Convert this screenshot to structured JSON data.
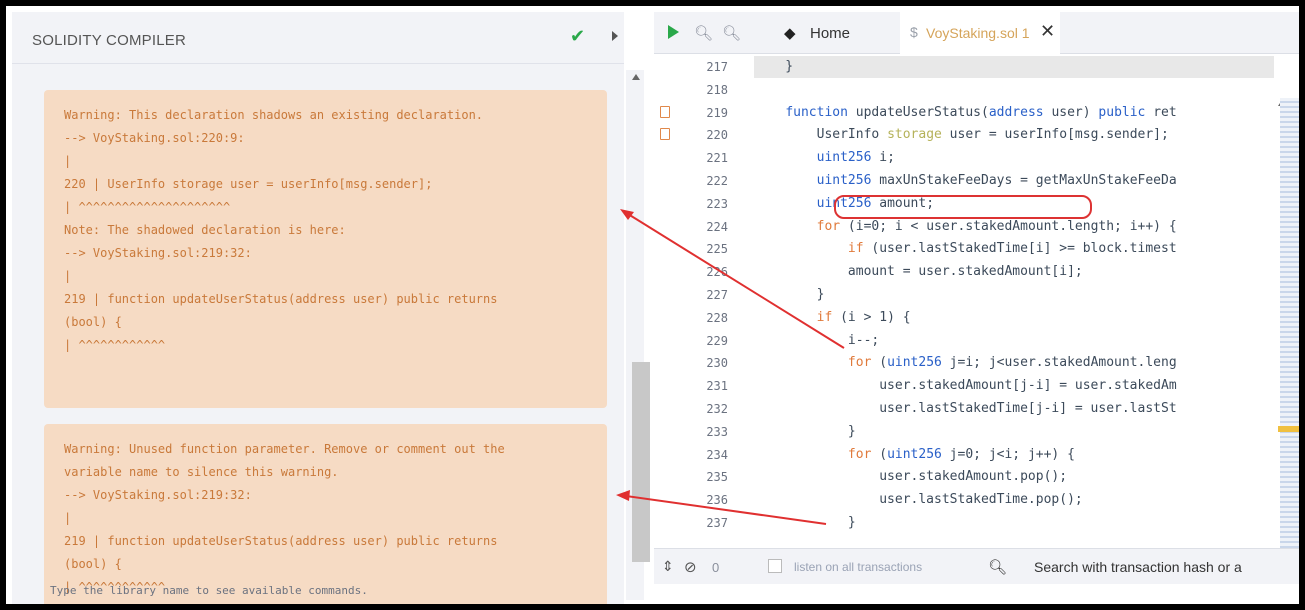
{
  "left_panel": {
    "title": "SOLIDITY COMPILER",
    "warnings": [
      "Warning: This declaration shadows an existing declaration.\n--> VoyStaking.sol:220:9:\n|\n220 | UserInfo storage user = userInfo[msg.sender];\n| ^^^^^^^^^^^^^^^^^^^^^\nNote: The shadowed declaration is here:\n--> VoyStaking.sol:219:32:\n|\n219 | function updateUserStatus(address user) public returns\n(bool) {\n| ^^^^^^^^^^^^",
      "Warning: Unused function parameter. Remove or comment out the\nvariable name to silence this warning.\n--> VoyStaking.sol:219:32:\n|\n219 | function updateUserStatus(address user) public returns\n(bool) {\n| ^^^^^^^^^^^^"
    ]
  },
  "editor": {
    "tabs": {
      "home": "Home",
      "file": "VoyStaking.sol",
      "file_suffix": "1"
    },
    "lines": [
      {
        "n": "217",
        "text": "    }"
      },
      {
        "n": "218",
        "text": ""
      },
      {
        "n": "219",
        "text": "    function updateUserStatus(address user) public ret"
      },
      {
        "n": "220",
        "text": "        UserInfo storage user = userInfo[msg.sender];"
      },
      {
        "n": "221",
        "text": "        uint256 i;"
      },
      {
        "n": "222",
        "text": "        uint256 maxUnStakeFeeDays = getMaxUnStakeFeeDa"
      },
      {
        "n": "223",
        "text": "        uint256 amount;"
      },
      {
        "n": "224",
        "text": "        for (i=0; i < user.stakedAmount.length; i++) {"
      },
      {
        "n": "225",
        "text": "            if (user.lastStakedTime[i] >= block.timest"
      },
      {
        "n": "226",
        "text": "            amount = user.stakedAmount[i];"
      },
      {
        "n": "227",
        "text": "        }"
      },
      {
        "n": "228",
        "text": "        if (i > 1) {"
      },
      {
        "n": "229",
        "text": "            i--;"
      },
      {
        "n": "230",
        "text": "            for (uint256 j=i; j<user.stakedAmount.leng"
      },
      {
        "n": "231",
        "text": "                user.stakedAmount[j-i] = user.stakedAm"
      },
      {
        "n": "232",
        "text": "                user.lastStakedTime[j-i] = user.lastSt"
      },
      {
        "n": "233",
        "text": "            }"
      },
      {
        "n": "234",
        "text": "            for (uint256 j=0; j<i; j++) {"
      },
      {
        "n": "235",
        "text": "                user.stakedAmount.pop();"
      },
      {
        "n": "236",
        "text": "                user.lastStakedTime.pop();"
      },
      {
        "n": "237",
        "text": "            }"
      }
    ]
  },
  "terminal": {
    "tx_count": "0",
    "listen_label": "listen on all transactions",
    "search_placeholder": "Search with transaction hash or a",
    "hint": "Type the library name to see available commands."
  },
  "colors": {
    "warning_bg": "#f6dbc4",
    "warning_text": "#c9793a",
    "annotation_arrow": "#e03030"
  }
}
